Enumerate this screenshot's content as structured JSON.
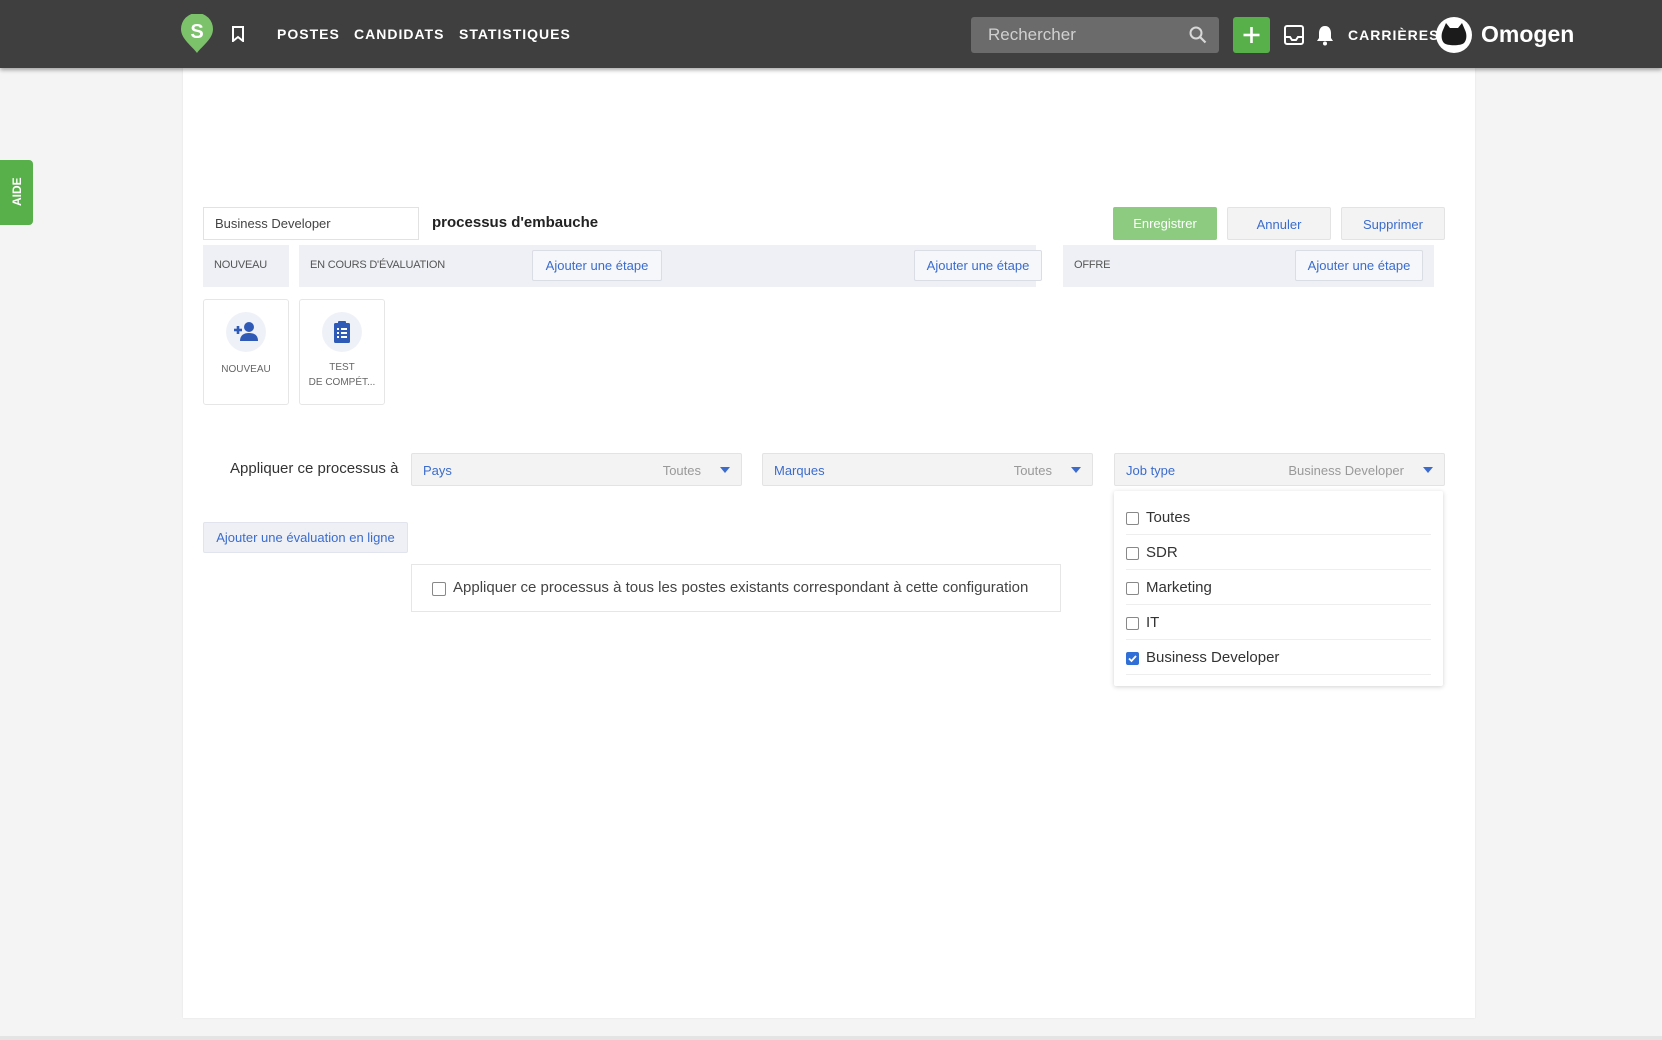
{
  "nav": {
    "items": [
      "POSTES",
      "CANDIDATS",
      "STATISTIQUES"
    ],
    "search_placeholder": "Rechercher",
    "careers_label": "CARRIÈRES",
    "company_name": "Omogen",
    "logo_letter": "S"
  },
  "help_tab": "AIDE",
  "process": {
    "name_value": "Business Developer",
    "label": "processus d'embauche",
    "save_label": "Enregistrer",
    "cancel_label": "Annuler",
    "delete_label": "Supprimer"
  },
  "stages": [
    {
      "name": "NOUVEAU"
    },
    {
      "name": "EN COURS D'ÉVALUATION",
      "add_label": "Ajouter une étape"
    },
    {
      "add_label": "Ajouter une étape"
    },
    {
      "name": "OFFRE",
      "add_label": "Ajouter une étape"
    }
  ],
  "cards": [
    {
      "line1": "NOUVEAU",
      "line2": "",
      "icon": "add-person-icon"
    },
    {
      "line1": "TEST",
      "line2": "DE COMPÉT...",
      "icon": "clipboard-icon"
    }
  ],
  "apply": {
    "label": "Appliquer ce processus à",
    "filters": [
      {
        "label": "Pays",
        "value": "Toutes"
      },
      {
        "label": "Marques",
        "value": "Toutes"
      },
      {
        "label": "Job type",
        "value": "Business Developer"
      }
    ],
    "online_eval_label": "Ajouter une évaluation en ligne",
    "apply_all_label": "Appliquer ce processus à tous les postes existants correspondant à cette configuration",
    "apply_all_checked": false
  },
  "job_type_options": [
    {
      "label": "Toutes",
      "checked": false
    },
    {
      "label": "SDR",
      "checked": false
    },
    {
      "label": "Marketing",
      "checked": false
    },
    {
      "label": "IT",
      "checked": false
    },
    {
      "label": "Business Developer",
      "checked": true
    }
  ],
  "colors": {
    "topbar": "#3f3f3f",
    "accent_green": "#58b04a",
    "link_blue": "#3b6ccd",
    "checkbox_blue": "#2f6fd6"
  }
}
